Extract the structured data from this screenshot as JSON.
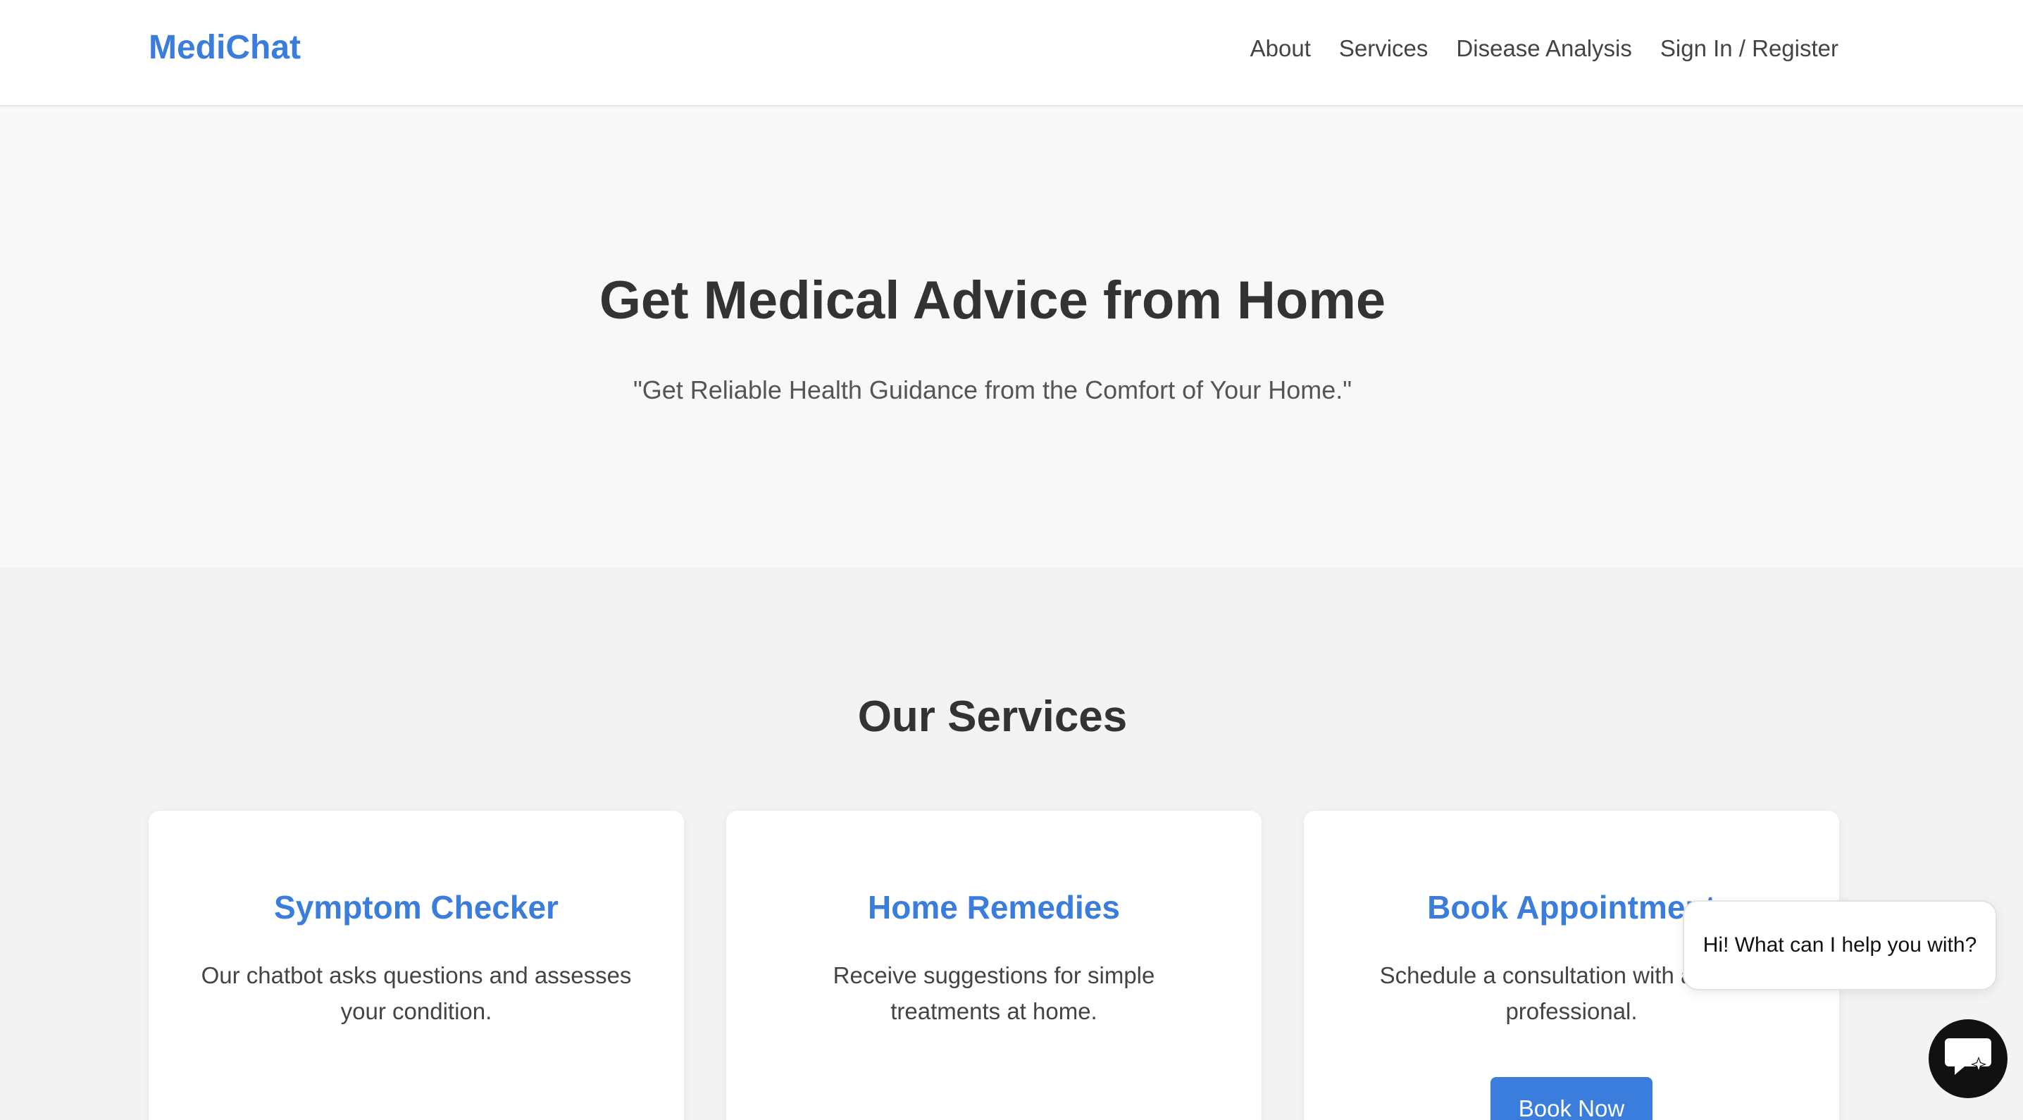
{
  "header": {
    "logo": "MediChat",
    "nav": [
      "About",
      "Services",
      "Disease Analysis",
      "Sign In / Register"
    ]
  },
  "hero": {
    "title": "Get Medical Advice from Home",
    "subtitle": "\"Get Reliable Health Guidance from the Comfort of Your Home.\""
  },
  "services": {
    "title": "Our Services",
    "cards": [
      {
        "title": "Symptom Checker",
        "text": "Our chatbot asks questions and assesses your condition."
      },
      {
        "title": "Home Remedies",
        "text": "Receive suggestions for simple treatments at home."
      },
      {
        "title": "Book Appointment",
        "text": "Schedule a consultation with a health professional.",
        "button": "Book Now"
      }
    ]
  },
  "chat": {
    "greeting": "Hi! What can I help you with?",
    "icon": "chat-sparkle-icon"
  },
  "colors": {
    "accent": "#3b7ddd",
    "text": "#333333",
    "background": "#f3f3f3"
  }
}
